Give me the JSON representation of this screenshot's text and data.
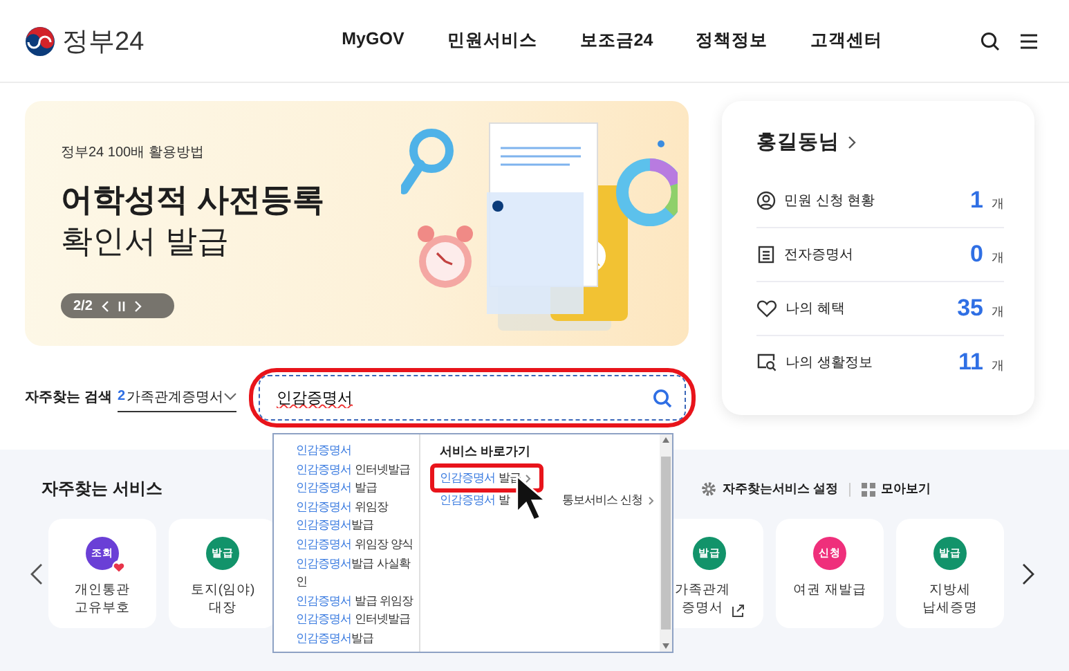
{
  "header": {
    "logo": "정부24",
    "nav": [
      {
        "label": "MyGOV"
      },
      {
        "label": "민원서비스"
      },
      {
        "label": "보조금24"
      },
      {
        "label": "정책정보"
      },
      {
        "label": "고객센터"
      }
    ]
  },
  "banner": {
    "eyebrow": "정부24 100배 활용방법",
    "title_lines": [
      "어학성적 사전등록",
      "확인서 발급"
    ],
    "pager": "2/2",
    "paused": false
  },
  "popular_search": {
    "label": "자주찾는 검색",
    "rank": "2",
    "term": "가족관계증명서"
  },
  "search": {
    "value": "인감증명서",
    "highlighted": true
  },
  "autocomplete": {
    "suggestions": [
      {
        "match": "인감증명서"
      },
      {
        "match": "인감증명서",
        "rest": " 인터넷발급"
      },
      {
        "match": "인감증명서",
        "rest": " 발급"
      },
      {
        "match": "인감증명서",
        "rest": " 위임장"
      },
      {
        "match": "인감증명서",
        "rest": "발급"
      },
      {
        "match": "인감증명서",
        "rest": " 위임장 양식"
      },
      {
        "match": "인감증명서",
        "rest": "발급 사실확인"
      },
      {
        "match": "인감증명서",
        "rest": " 발급 위임장"
      },
      {
        "match": "인감증명서",
        "rest": " 인터넷발급"
      },
      {
        "match": "인감증명서",
        "rest": "발급"
      }
    ],
    "shortcuts_title": "서비스 바로가기",
    "shortcuts": [
      {
        "match": "인감증명서",
        "rest": " 발급",
        "highlighted": true
      },
      {
        "match": "인감증명서",
        "rest": " 발",
        "tail": "통보서비스 신청",
        "highlighted": false
      }
    ]
  },
  "account": {
    "name": "홍길동님",
    "rows": [
      {
        "kind": "applications",
        "label": "민원 신청 현황",
        "count": "1",
        "unit": "개"
      },
      {
        "kind": "certificates",
        "label": "전자증명서",
        "count": "0",
        "unit": "개"
      },
      {
        "kind": "benefits",
        "label": "나의 혜택",
        "count": "35",
        "unit": "개"
      },
      {
        "kind": "life",
        "label": "나의 생활정보",
        "count": "11",
        "unit": "개"
      }
    ]
  },
  "services": {
    "title": "자주찾는 서비스",
    "settings": "자주찾는서비스 설정",
    "view_all": "모아보기",
    "items": [
      {
        "badge": "조회",
        "color": "#6a3fd6",
        "label": "개인통관\n고유부호",
        "favorite": true,
        "external": false,
        "after_gap": false
      },
      {
        "badge": "발급",
        "color": "#12936a",
        "label": "토지(임야)\n대장",
        "favorite": false,
        "external": false,
        "after_gap": false
      },
      {
        "badge": "발급",
        "color": "#12936a",
        "label": "가족관계\n증명서",
        "favorite": false,
        "external": true,
        "after_gap": true
      },
      {
        "badge": "신청",
        "color": "#ef2f7b",
        "label": "여권 재발급",
        "favorite": false,
        "external": false,
        "after_gap": false
      },
      {
        "badge": "발급",
        "color": "#12936a",
        "label": "지방세\n납세증명",
        "favorite": false,
        "external": false,
        "after_gap": false
      }
    ]
  }
}
